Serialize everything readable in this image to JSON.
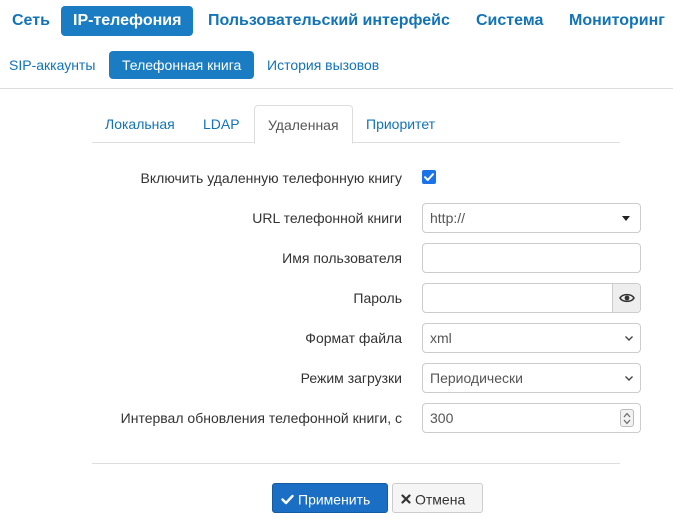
{
  "topnav": {
    "items": [
      {
        "label": "Сеть"
      },
      {
        "label": "IP-телефония"
      },
      {
        "label": "Пользовательский интерфейс"
      },
      {
        "label": "Система"
      },
      {
        "label": "Мониторинг"
      }
    ],
    "active_index": 1
  },
  "subnav": {
    "items": [
      {
        "label": "SIP-аккаунты"
      },
      {
        "label": "Телефонная книга"
      },
      {
        "label": "История вызовов"
      }
    ],
    "active_index": 1
  },
  "tabs": {
    "items": [
      {
        "label": "Локальная"
      },
      {
        "label": "LDAP"
      },
      {
        "label": "Удаленная"
      },
      {
        "label": "Приоритет"
      }
    ],
    "active_index": 2
  },
  "form": {
    "enable": {
      "label": "Включить удаленную телефонную книгу",
      "checked": true
    },
    "url": {
      "label": "URL телефонной книги",
      "value": "http://"
    },
    "username": {
      "label": "Имя пользователя",
      "value": ""
    },
    "password": {
      "label": "Пароль",
      "value": ""
    },
    "format": {
      "label": "Формат файла",
      "value": "xml"
    },
    "mode": {
      "label": "Режим загрузки",
      "value": "Периодически"
    },
    "interval": {
      "label": "Интервал обновления телефонной книги, с",
      "value": "300"
    }
  },
  "buttons": {
    "apply": "Применить",
    "cancel": "Отмена"
  },
  "colors": {
    "accent": "#1a7dc3",
    "link": "#1273b8",
    "primary_button": "#1a6fc4",
    "checkbox": "#1a73e8"
  },
  "icons": {
    "check": "check-icon",
    "eye": "eye-icon",
    "times": "times-icon",
    "caret": "caret-down-icon",
    "chevron": "chevron-down-icon",
    "spinner": "spinner-icon"
  }
}
